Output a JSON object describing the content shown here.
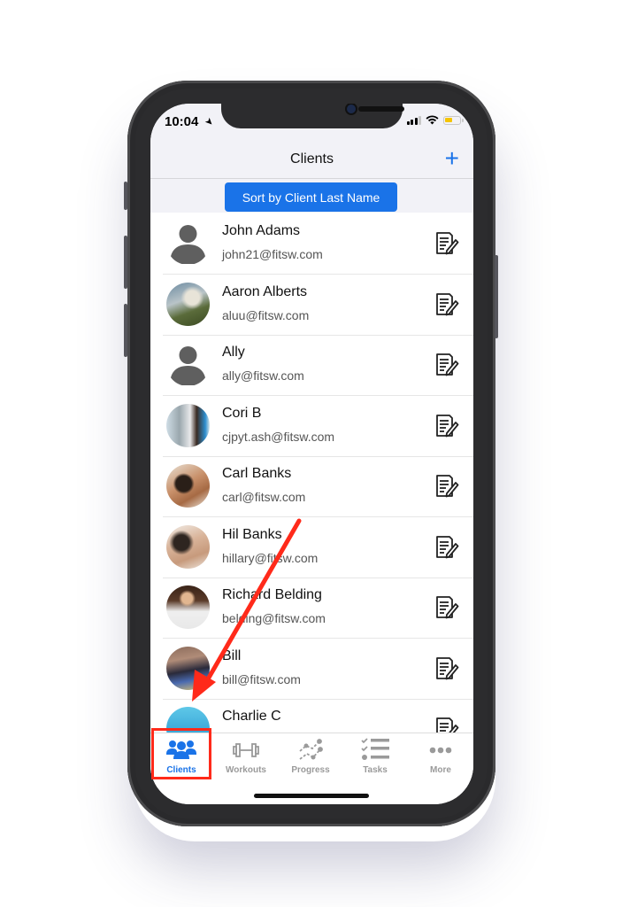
{
  "status_bar": {
    "time": "10:04",
    "battery_color": "#f5c400"
  },
  "header": {
    "title": "Clients",
    "add_icon": "plus-icon"
  },
  "sort_button": {
    "label": "Sort by Client Last Name",
    "color": "#1a73e8"
  },
  "clients": [
    {
      "name": "John Adams",
      "email": "john21@fitsw.com",
      "avatar": "default"
    },
    {
      "name": "Aaron Alberts",
      "email": "aluu@fitsw.com",
      "avatar": "photo-waterfall"
    },
    {
      "name": "Ally",
      "email": "ally@fitsw.com",
      "avatar": "default"
    },
    {
      "name": "Cori  B",
      "email": "cjpyt.ash@fitsw.com",
      "avatar": "photo-trainers"
    },
    {
      "name": "Carl Banks",
      "email": "carl@fitsw.com",
      "avatar": "photo-workout"
    },
    {
      "name": "Hil Banks",
      "email": "hillary@fitsw.com",
      "avatar": "photo-athlete"
    },
    {
      "name": "Richard Belding",
      "email": "belding@fitsw.com",
      "avatar": "photo-man-tie"
    },
    {
      "name": "Bill",
      "email": "bill@fitsw.com",
      "avatar": "photo-gym"
    },
    {
      "name": "Charlie C",
      "email": "",
      "avatar": "photo-ropes"
    }
  ],
  "tabs": [
    {
      "label": "Clients",
      "icon": "users-icon",
      "active": true
    },
    {
      "label": "Workouts",
      "icon": "dumbbell-icon",
      "active": false
    },
    {
      "label": "Progress",
      "icon": "progress-chart-icon",
      "active": false
    },
    {
      "label": "Tasks",
      "icon": "checklist-icon",
      "active": false
    },
    {
      "label": "More",
      "icon": "more-dots-icon",
      "active": false
    }
  ],
  "annotation": {
    "color": "#ff2a1a",
    "target": "Clients"
  }
}
